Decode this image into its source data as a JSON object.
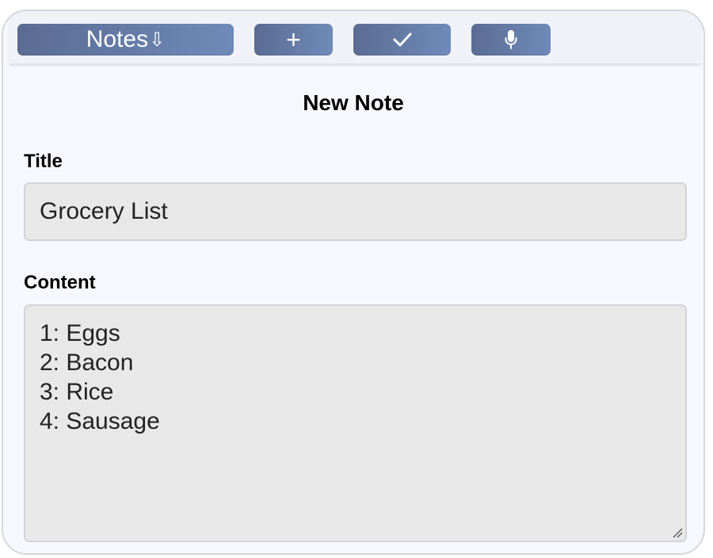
{
  "toolbar": {
    "notes_label": "Notes",
    "notes_arrow": "⇩",
    "add_label": "+"
  },
  "icons": {
    "save": "check-icon",
    "mic": "microphone-icon",
    "notes_dropdown": "down-arrow-icon"
  },
  "colors": {
    "button_gradient_start": "#5b6c93",
    "button_gradient_end": "#6f8ab9",
    "field_background": "#e8e8e8",
    "card_background": "#f7f8fd"
  },
  "form": {
    "heading": "New Note",
    "title_label": "Title",
    "title_value": "Grocery List",
    "content_label": "Content",
    "content_lines": [
      "1: Eggs",
      "2: Bacon",
      "3: Rice",
      "4: Sausage"
    ]
  }
}
